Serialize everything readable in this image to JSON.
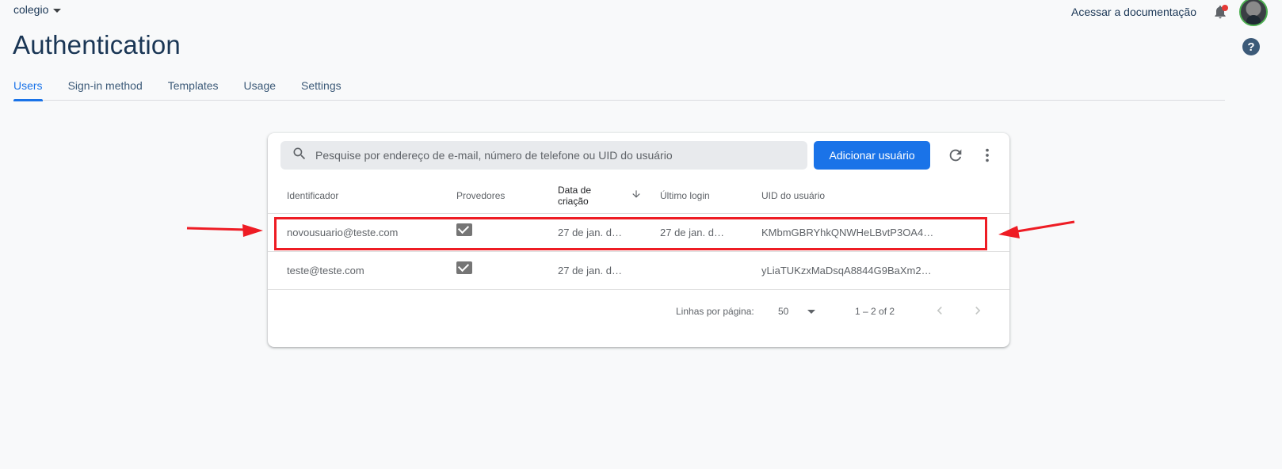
{
  "topbar": {
    "project_name": "colegio",
    "docs_link": "Acessar a documentação"
  },
  "page": {
    "title": "Authentication"
  },
  "tabs": [
    {
      "label": "Users",
      "active": true
    },
    {
      "label": "Sign-in method",
      "active": false
    },
    {
      "label": "Templates",
      "active": false
    },
    {
      "label": "Usage",
      "active": false
    },
    {
      "label": "Settings",
      "active": false
    }
  ],
  "toolbar": {
    "search_placeholder": "Pesquise por endereço de e-mail, número de telefone ou UID do usuário",
    "search_value": "",
    "add_user_label": "Adicionar usuário"
  },
  "table": {
    "headers": {
      "identifier": "Identificador",
      "providers": "Provedores",
      "created_line1": "Data de",
      "created_line2": "criação",
      "last_login": "Último login",
      "uid": "UID do usuário"
    },
    "rows": [
      {
        "identifier": "novousuario@teste.com",
        "provider_icon": "mail-icon",
        "created": "27 de jan. d…",
        "last_login": "27 de jan. d…",
        "uid": "KMbmGBRYhkQNWHeLBvtP3OA4…",
        "highlighted": true
      },
      {
        "identifier": "teste@teste.com",
        "provider_icon": "mail-icon",
        "created": "27 de jan. d…",
        "last_login": "",
        "uid": "yLiaTUKzxMaDsqA8844G9BaXm2…",
        "highlighted": false
      }
    ]
  },
  "pagination": {
    "rows_per_page_label": "Linhas por página:",
    "rows_per_page_value": "50",
    "range_label": "1 – 2 of 2"
  },
  "colors": {
    "accent": "#1a73e8",
    "title": "#1a3655",
    "annotation": "#ee1c24"
  }
}
